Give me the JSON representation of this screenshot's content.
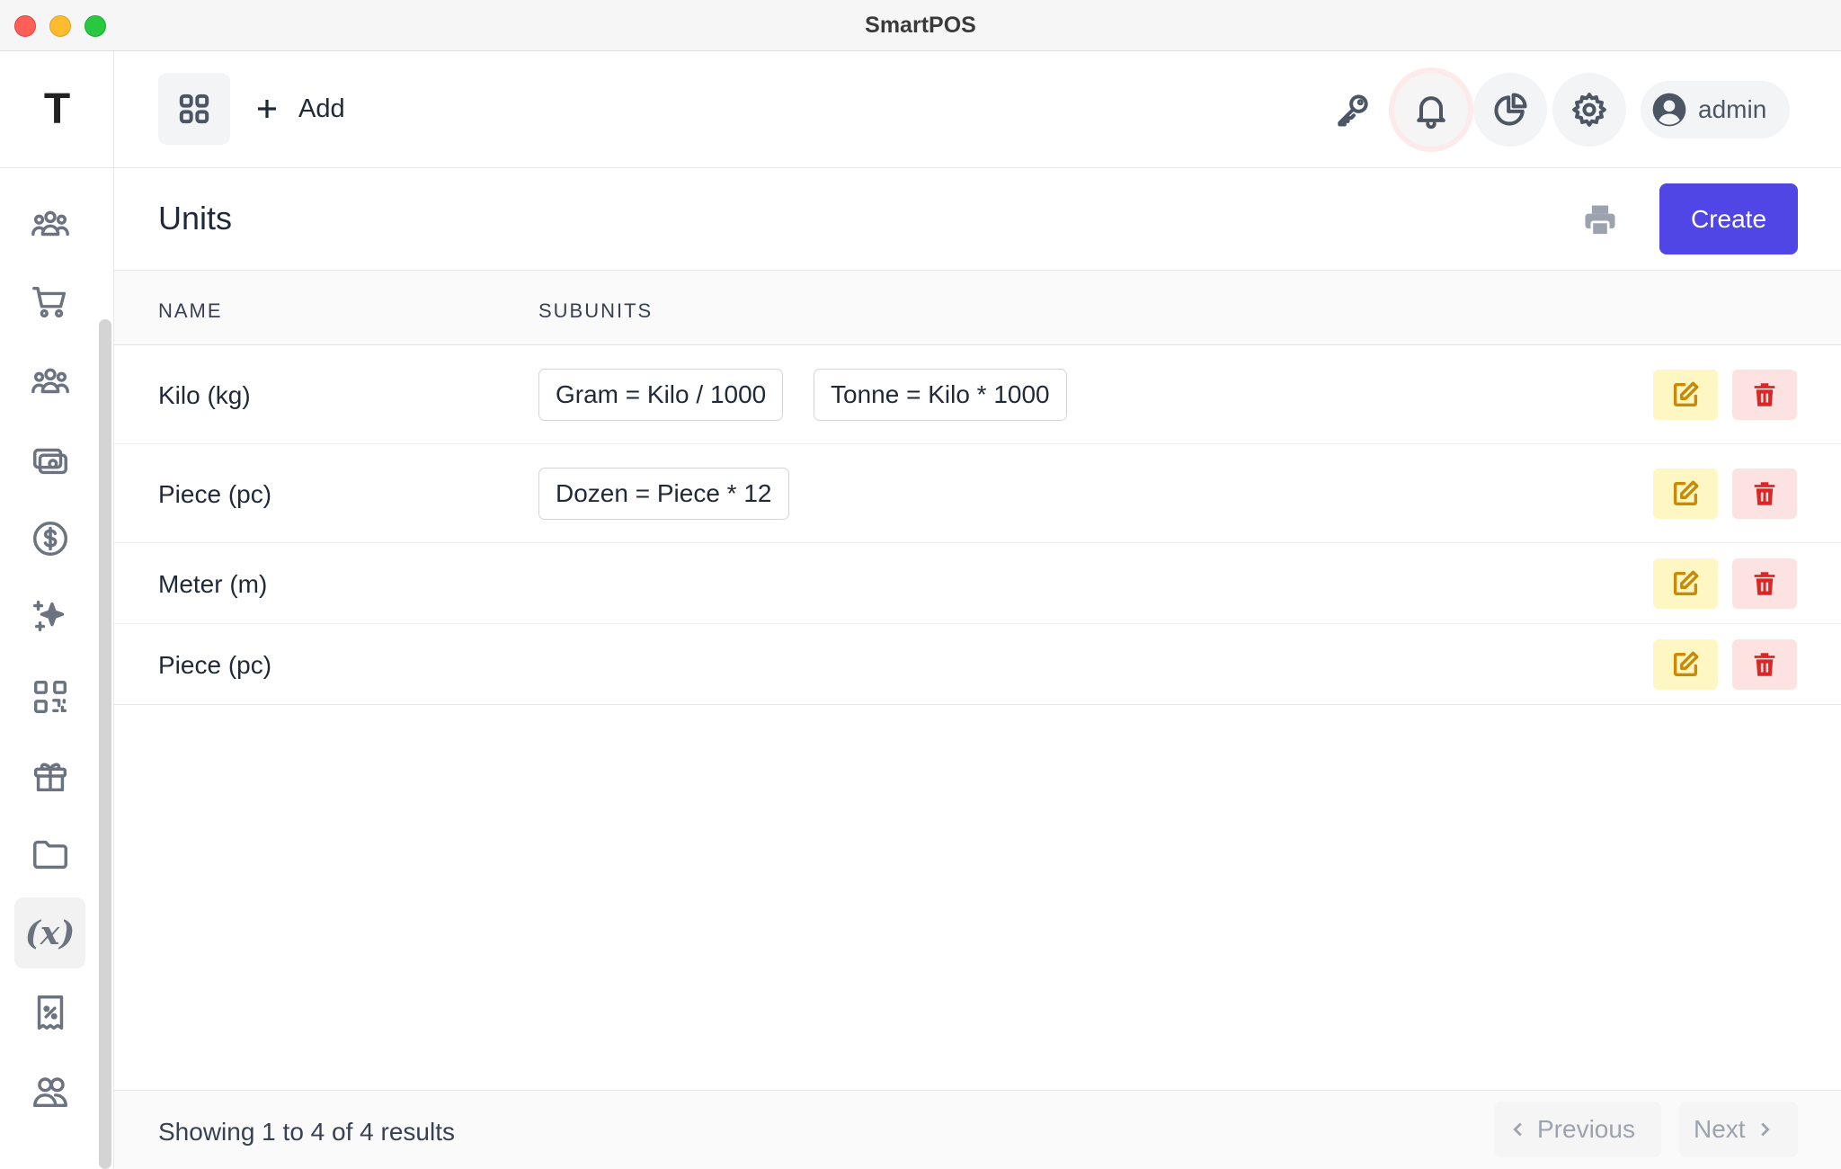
{
  "window": {
    "title": "SmartPOS"
  },
  "sidebar": {
    "logo": "T",
    "items": [
      {
        "icon": "users-group-icon"
      },
      {
        "icon": "cart-icon"
      },
      {
        "icon": "users-group-icon"
      },
      {
        "icon": "cash-icon"
      },
      {
        "icon": "dollar-circle-icon"
      },
      {
        "icon": "sparkles-icon"
      },
      {
        "icon": "qr-code-icon"
      },
      {
        "icon": "gift-icon"
      },
      {
        "icon": "folder-icon"
      },
      {
        "icon": "variable-icon",
        "label": "(x)",
        "active": true
      },
      {
        "icon": "receipt-percent-icon"
      },
      {
        "icon": "users-icon"
      }
    ]
  },
  "topbar": {
    "add_label": "Add",
    "user_name": "admin"
  },
  "page": {
    "title": "Units",
    "create_label": "Create"
  },
  "table": {
    "headers": {
      "name": "NAME",
      "subunits": "SUBUNITS"
    },
    "rows": [
      {
        "name": "Kilo (kg)",
        "subunits": [
          "Gram = Kilo / 1000",
          "Tonne = Kilo * 1000"
        ]
      },
      {
        "name": "Piece (pc)",
        "subunits": [
          "Dozen = Piece * 12"
        ]
      },
      {
        "name": "Meter (m)",
        "subunits": []
      },
      {
        "name": "Piece (pc)",
        "subunits": []
      }
    ]
  },
  "footer": {
    "showing": "Showing 1 to 4 of 4 results",
    "previous_label": "Previous",
    "next_label": "Next"
  },
  "colors": {
    "primary": "#4f46e5",
    "edit_bg": "#fef6c3",
    "edit_icon": "#ca8a04",
    "delete_bg": "#fde2e2",
    "delete_icon": "#dc2626"
  }
}
